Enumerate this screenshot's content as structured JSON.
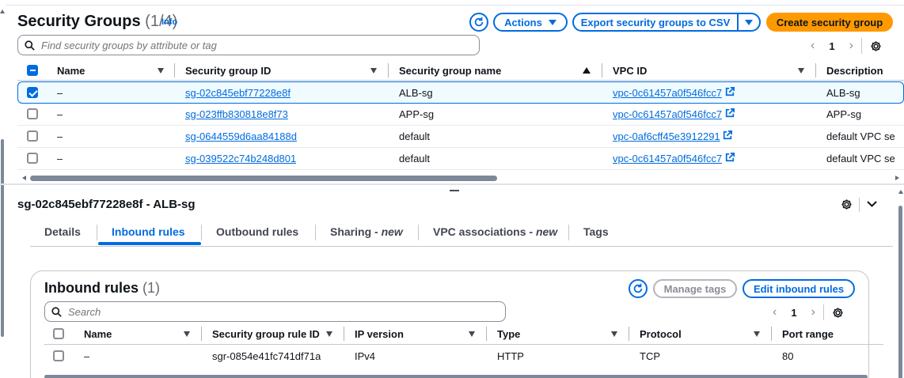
{
  "header": {
    "title": "Security Groups",
    "count": "(1/4)",
    "info": "Info",
    "actions_label": "Actions",
    "export_label": "Export security groups to CSV",
    "create_label": "Create security group",
    "search_placeholder": "Find security groups by attribute or tag",
    "page": "1"
  },
  "table": {
    "columns": [
      "Name",
      "Security group ID",
      "Security group name",
      "VPC ID",
      "Description"
    ],
    "rows": [
      {
        "name": "–",
        "sg_id": "sg-02c845ebf77228e8f",
        "sg_name": "ALB-sg",
        "vpc": "vpc-0c61457a0f546fcc7",
        "desc": "ALB-sg",
        "selected": true
      },
      {
        "name": "–",
        "sg_id": "sg-023ffb830818e8f73",
        "sg_name": "APP-sg",
        "vpc": "vpc-0c61457a0f546fcc7",
        "desc": "APP-sg",
        "selected": false
      },
      {
        "name": "–",
        "sg_id": "sg-0644559d6aa84188d",
        "sg_name": "default",
        "vpc": "vpc-0af6cff45e3912291",
        "desc": "default VPC se",
        "selected": false
      },
      {
        "name": "–",
        "sg_id": "sg-039522c74b248d801",
        "sg_name": "default",
        "vpc": "vpc-0c61457a0f546fcc7",
        "desc": "default VPC se",
        "selected": false
      }
    ]
  },
  "detail": {
    "title": "sg-02c845ebf77228e8f - ALB-sg",
    "tabs": [
      {
        "label": "Details"
      },
      {
        "label": "Inbound rules"
      },
      {
        "label": "Outbound rules"
      },
      {
        "label": "Sharing - ",
        "suffix": "new"
      },
      {
        "label": "VPC associations - ",
        "suffix": "new"
      },
      {
        "label": "Tags"
      }
    ],
    "active_tab": "Inbound rules"
  },
  "inbound": {
    "title": "Inbound rules",
    "count": "(1)",
    "manage_tags": "Manage tags",
    "edit_label": "Edit inbound rules",
    "search_placeholder": "Search",
    "page": "1",
    "columns": [
      "Name",
      "Security group rule ID",
      "IP version",
      "Type",
      "Protocol",
      "Port range"
    ],
    "rows": [
      {
        "name": "–",
        "rule_id": "sgr-0854e41fc741df71a",
        "ip": "IPv4",
        "type": "HTTP",
        "protocol": "TCP",
        "port": "80"
      }
    ]
  },
  "colors": {
    "accent": "#006ce0",
    "primary_button": "#ff9900"
  },
  "icons": [
    "refresh-icon",
    "caret-down-icon",
    "search-icon",
    "gear-icon",
    "external-link-icon",
    "chevron-left-icon",
    "chevron-right-icon",
    "chevron-down-icon",
    "sort-down-icon",
    "sort-up-icon"
  ]
}
